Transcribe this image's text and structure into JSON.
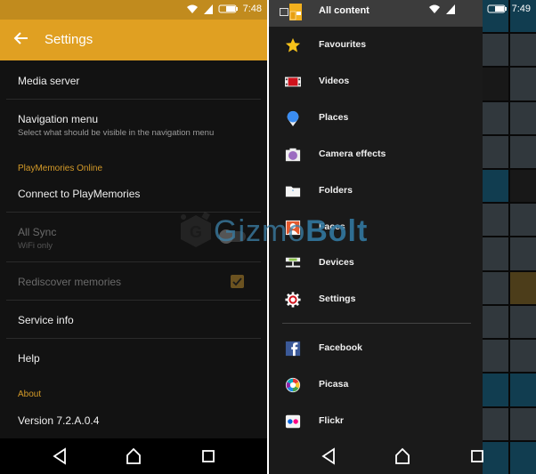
{
  "left": {
    "status": {
      "time": "7:48"
    },
    "appbar": {
      "title": "Settings",
      "back_icon": "arrow-left-icon"
    },
    "settings": [
      {
        "title": "Media server",
        "subtitle": "",
        "enabled": true
      },
      {
        "title": "Navigation menu",
        "subtitle": "Select what should be visible in the navigation menu",
        "enabled": true
      },
      {
        "title": "Connect to PlayMemories",
        "subtitle": "",
        "enabled": true
      },
      {
        "title": "All Sync",
        "subtitle": "WiFi only",
        "enabled": false,
        "control": "toggle",
        "checked": false
      },
      {
        "title": "Rediscover memories",
        "subtitle": "",
        "enabled": false,
        "control": "checkbox",
        "checked": true
      },
      {
        "title": "Service info",
        "subtitle": "",
        "enabled": true
      },
      {
        "title": "Help",
        "subtitle": "",
        "enabled": true
      },
      {
        "title": "Version 7.2.A.0.4",
        "subtitle": "",
        "enabled": true
      }
    ],
    "categories": {
      "playmemories": "PlayMemories Online",
      "about": "About"
    },
    "accent": "#e0a022"
  },
  "right": {
    "status": {
      "time": "7:49"
    },
    "drawer": {
      "header": "All content",
      "items": [
        {
          "label": "Favourites",
          "icon": "star-icon"
        },
        {
          "label": "Videos",
          "icon": "film-icon"
        },
        {
          "label": "Places",
          "icon": "map-pin-icon"
        },
        {
          "label": "Camera effects",
          "icon": "camera-icon"
        },
        {
          "label": "Folders",
          "icon": "folder-icon"
        },
        {
          "label": "Faces",
          "icon": "face-icon"
        },
        {
          "label": "Devices",
          "icon": "devices-icon"
        },
        {
          "label": "Settings",
          "icon": "gear-icon"
        }
      ],
      "services": [
        {
          "label": "Facebook",
          "icon": "facebook-icon"
        },
        {
          "label": "Picasa",
          "icon": "picasa-icon"
        },
        {
          "label": "Flickr",
          "icon": "flickr-icon"
        }
      ]
    }
  },
  "watermark": {
    "part1": "Gizmo",
    "part2": "Bolt"
  }
}
